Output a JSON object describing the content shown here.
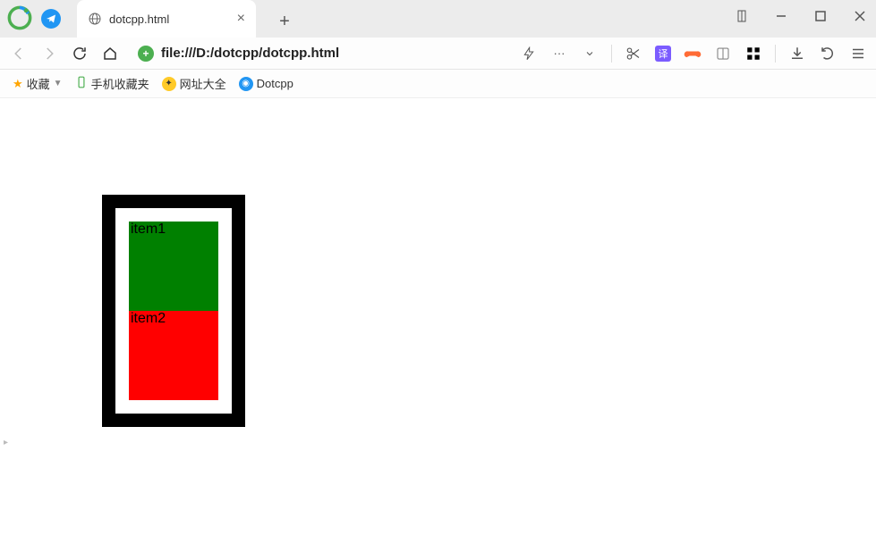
{
  "titlebar": {
    "tab_title": "dotcpp.html",
    "tab_close": "×",
    "newtab": "+"
  },
  "toolbar": {
    "url": "file:///D:/dotcpp/dotcpp.html",
    "more": "···"
  },
  "bookmarks": {
    "favorites": "收藏",
    "mobile": "手机收藏夹",
    "sites": "网址大全",
    "dotcpp": "Dotcpp"
  },
  "content": {
    "items": [
      "item1",
      "item2"
    ]
  }
}
